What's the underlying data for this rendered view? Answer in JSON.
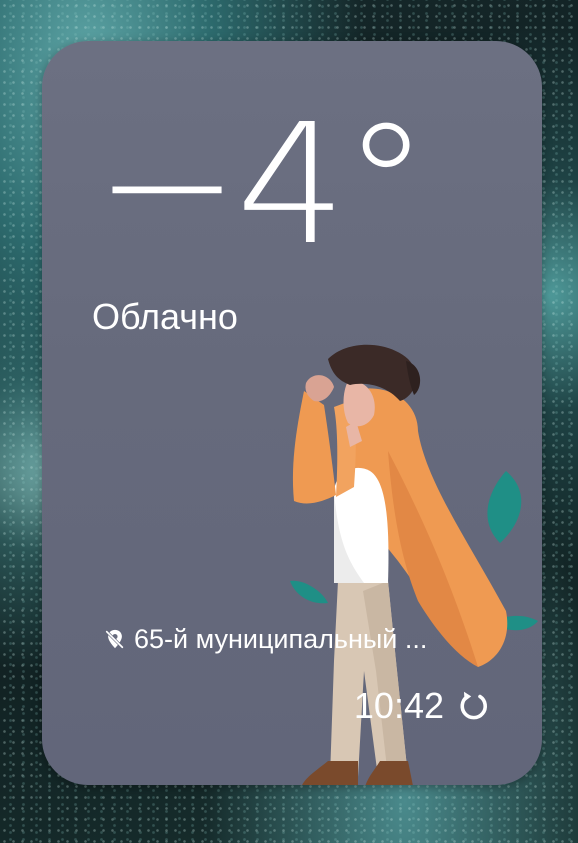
{
  "weather_widget": {
    "temperature": "−4°",
    "condition": "Облачно",
    "location": "65-й муниципальный ...",
    "updated_time": "10:42",
    "icons": {
      "location": "location-off-icon",
      "refresh": "refresh-icon"
    },
    "colors": {
      "card_background": "#686c7e",
      "text": "#ffffff",
      "coat": "#ef9a52",
      "leaf": "#1f8f86"
    }
  }
}
